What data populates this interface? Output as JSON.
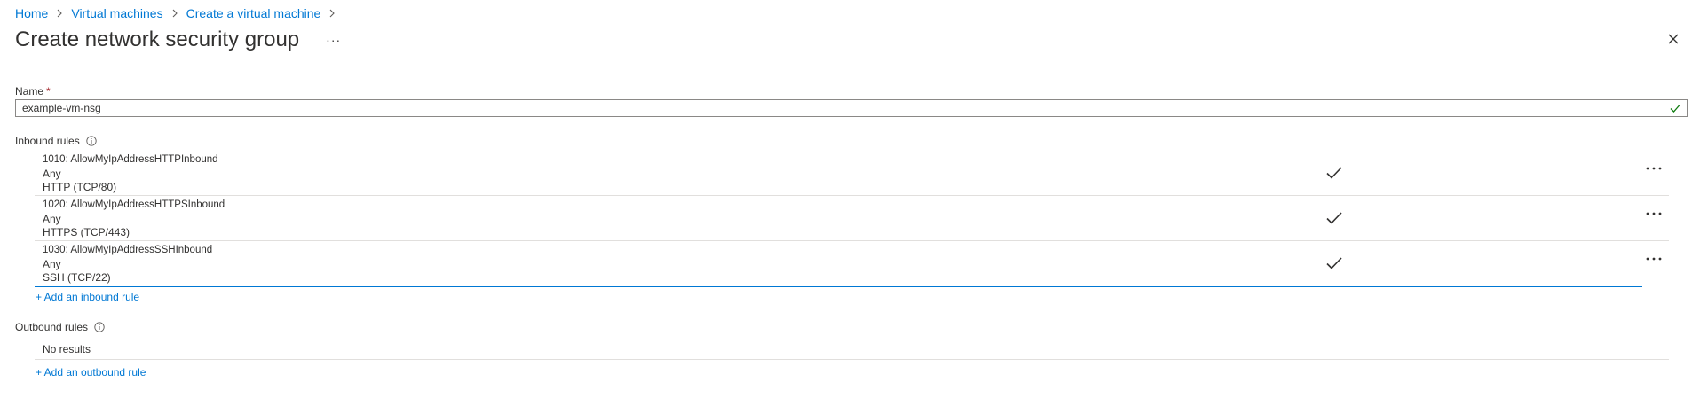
{
  "breadcrumb": {
    "items": [
      "Home",
      "Virtual machines",
      "Create a virtual machine"
    ]
  },
  "header": {
    "title": "Create network security group",
    "more_label": "···"
  },
  "name_field": {
    "label": "Name",
    "required_mark": "*",
    "value": "example-vm-nsg"
  },
  "inbound": {
    "label": "Inbound rules",
    "rules": [
      {
        "name": "1010: AllowMyIpAddressHTTPInbound",
        "source": "Any",
        "service": "HTTP (TCP/80)"
      },
      {
        "name": "1020: AllowMyIpAddressHTTPSInbound",
        "source": "Any",
        "service": "HTTPS (TCP/443)"
      },
      {
        "name": "1030: AllowMyIpAddressSSHInbound",
        "source": "Any",
        "service": "SSH (TCP/22)"
      }
    ],
    "add_label": "+ Add an inbound rule"
  },
  "outbound": {
    "label": "Outbound rules",
    "empty_text": "No results",
    "add_label": "+ Add an outbound rule"
  },
  "colors": {
    "link": "#0078d4",
    "valid": "#107c10",
    "required": "#a4262c",
    "border": "#8a8886",
    "divider": "#e1dfdd"
  },
  "icons": {
    "breadcrumb_separator": "chevron-right-icon",
    "close": "close-icon",
    "valid": "checkmark-icon",
    "info": "info-icon",
    "rule_enabled": "checkmark-icon",
    "rule_more": "more-icon"
  }
}
